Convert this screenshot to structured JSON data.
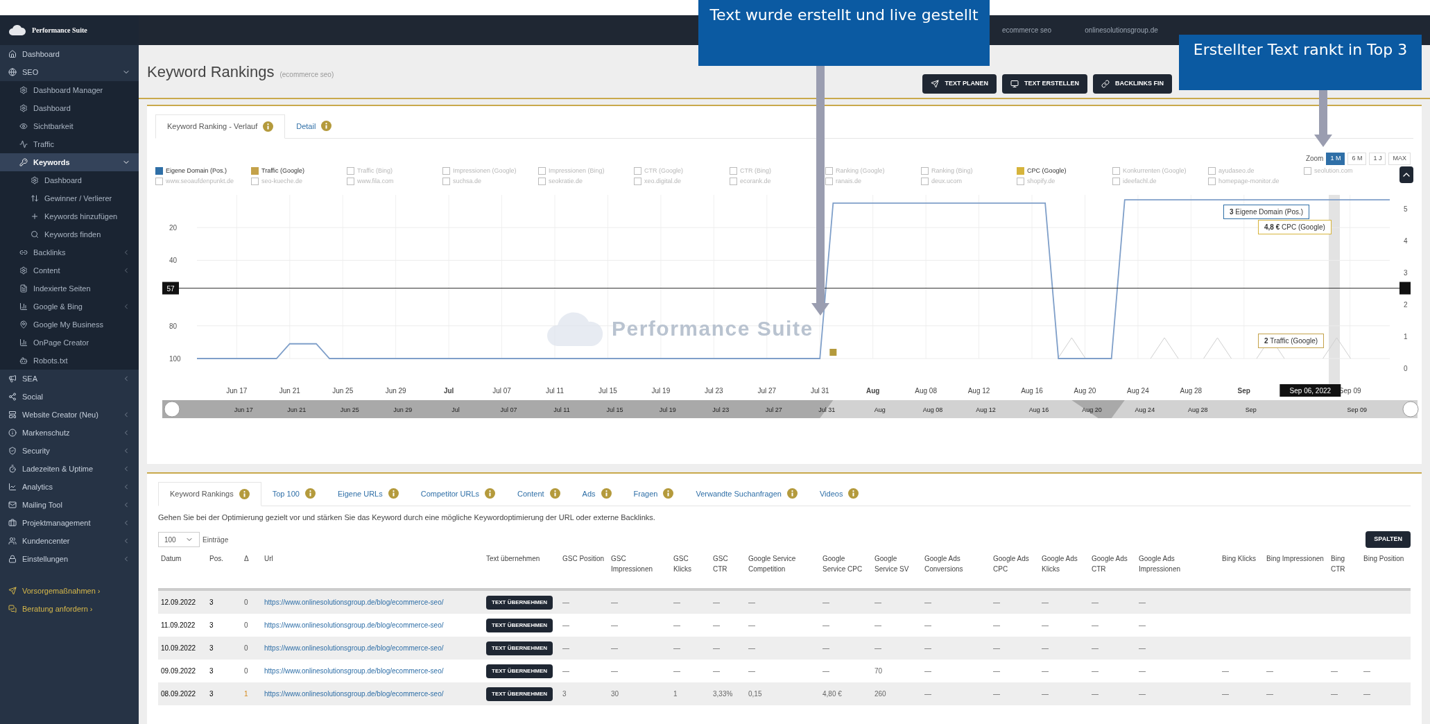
{
  "annotations": [
    {
      "text": "Text wurde erstellt und live gestellt"
    },
    {
      "text": "Erstellter Text rankt in Top 3"
    }
  ],
  "sidebar": {
    "logo": "Performance Suite",
    "items": [
      {
        "label": "Dashboard"
      },
      {
        "label": "SEO",
        "expanded": true,
        "children": [
          {
            "label": "Dashboard Manager"
          },
          {
            "label": "Dashboard"
          },
          {
            "label": "Sichtbarkeit"
          },
          {
            "label": "Traffic"
          },
          {
            "label": "Keywords",
            "selected": true,
            "expanded": true,
            "children": [
              {
                "label": "Dashboard"
              },
              {
                "label": "Gewinner / Verlierer"
              },
              {
                "label": "Keywords hinzufügen"
              },
              {
                "label": "Keywords finden"
              }
            ]
          },
          {
            "label": "Backlinks",
            "expanded": false
          },
          {
            "label": "Content",
            "expanded": false
          },
          {
            "label": "Indexierte Seiten"
          },
          {
            "label": "Google & Bing",
            "expanded": false
          },
          {
            "label": "Google My Business"
          },
          {
            "label": "OnPage Creator"
          },
          {
            "label": "Robots.txt"
          }
        ]
      },
      {
        "label": "SEA",
        "expanded": false
      },
      {
        "label": "Social"
      },
      {
        "label": "Website Creator (Neu)",
        "expanded": false
      },
      {
        "label": "Markenschutz",
        "expanded": false
      },
      {
        "label": "Security",
        "expanded": false
      },
      {
        "label": "Ladezeiten & Uptime",
        "expanded": false
      },
      {
        "label": "Analytics",
        "expanded": false
      },
      {
        "label": "Mailing Tool",
        "expanded": false
      },
      {
        "label": "Projektmanagement",
        "expanded": false
      },
      {
        "label": "Kundencenter",
        "expanded": false
      },
      {
        "label": "Einstellungen",
        "expanded": false
      }
    ],
    "extras": [
      {
        "label": "Vorsorgemaßnahmen ›"
      },
      {
        "label": "Beratung anfordern ›"
      }
    ]
  },
  "topbar": {
    "project": "ecommerce seo",
    "account": "onlinesolutionsgroup.de"
  },
  "header": {
    "title": "Keyword Rankings",
    "subtitle": "(ecommerce seo)",
    "buttons": [
      "TEXT PLANEN",
      "TEXT ERSTELLEN",
      "BACKLINKS FIN"
    ]
  },
  "chart_panel": {
    "tabs": [
      {
        "label": "Keyword Ranking - Verlauf",
        "selected": true
      },
      {
        "label": "Detail",
        "selected": false
      }
    ],
    "zoom_label": "Zoom",
    "ranges": [
      {
        "label": "1 M",
        "selected": true
      },
      {
        "label": "6 M",
        "selected": false
      },
      {
        "label": "1 J",
        "selected": false
      },
      {
        "label": "MAX",
        "selected": false
      }
    ],
    "legend_rows": [
      [
        {
          "label": "Eigene Domain (Pos.)",
          "checked": true,
          "color": "#2f6fa7"
        },
        {
          "label": "Traffic (Google)",
          "checked": true,
          "color": "#c4a24a"
        },
        {
          "label": "Traffic (Bing)",
          "checked": false
        },
        {
          "label": "Impressionen (Google)",
          "checked": false
        },
        {
          "label": "Impressionen (Bing)",
          "checked": false
        },
        {
          "label": "CTR (Google)",
          "checked": false
        },
        {
          "label": "CTR (Bing)",
          "checked": false
        },
        {
          "label": "Ranking (Google)",
          "checked": false
        },
        {
          "label": "Ranking (Bing)",
          "checked": false
        },
        {
          "label": "CPC (Google)",
          "checked": true,
          "color": "#d6b43c"
        },
        {
          "label": "Konkurrenten (Google)",
          "checked": false
        },
        {
          "label": "ayudaseo.de",
          "checked": false
        },
        {
          "label": "seolution.com",
          "checked": false
        }
      ],
      [
        {
          "label": "www.seoaufdenpunkt.de",
          "checked": false
        },
        {
          "label": "seo-kueche.de",
          "checked": false
        },
        {
          "label": "www.fila.com",
          "checked": false
        },
        {
          "label": "suchsa.de",
          "checked": false
        },
        {
          "label": "seokratie.de",
          "checked": false
        },
        {
          "label": "xeo.digital.de",
          "checked": false
        },
        {
          "label": "ecorank.de",
          "checked": false
        },
        {
          "label": "ranais.de",
          "checked": false
        },
        {
          "label": "deux.ucom",
          "checked": false
        },
        {
          "label": "shopify.de",
          "checked": false
        },
        {
          "label": "ideefachl.de",
          "checked": false
        },
        {
          "label": "homepage-monitor.de",
          "checked": false
        }
      ]
    ],
    "watermark": "Performance Suite",
    "chart_data": {
      "type": "line",
      "categories": [
        null,
        null,
        null,
        "Jun 17",
        null,
        null,
        null,
        "Jun 21",
        null,
        null,
        null,
        "Jun 25",
        null,
        null,
        null,
        "Jun 29",
        null,
        null,
        null,
        "Jul",
        null,
        null,
        null,
        "Jul 07",
        null,
        null,
        null,
        "Jul 11",
        null,
        null,
        null,
        "Jul 15",
        null,
        null,
        null,
        "Jul 19",
        null,
        null,
        null,
        "Jul 23",
        null,
        null,
        null,
        "Jul 27",
        null,
        null,
        null,
        "Jul 31",
        null,
        null,
        null,
        "Aug",
        null,
        null,
        null,
        "Aug 08",
        null,
        null,
        null,
        "Aug 12",
        null,
        null,
        null,
        "Aug 16",
        null,
        null,
        null,
        "Aug 20",
        null,
        null,
        null,
        "Aug 24",
        null,
        null,
        null,
        "Aug 28",
        null,
        null,
        null,
        "Sep",
        null,
        null,
        null,
        null,
        null,
        null,
        null,
        "Sep 09",
        null,
        null,
        null
      ],
      "series": [
        {
          "name": "Eigene Domain (Pos.)",
          "color": "#7f9fc9",
          "values": [
            100,
            100,
            100,
            100,
            100,
            100,
            100,
            91,
            91,
            91,
            100,
            100,
            100,
            100,
            100,
            100,
            100,
            100,
            100,
            100,
            100,
            100,
            100,
            100,
            100,
            100,
            100,
            100,
            100,
            100,
            100,
            100,
            100,
            100,
            100,
            100,
            100,
            100,
            100,
            100,
            100,
            100,
            100,
            100,
            100,
            100,
            100,
            100,
            5,
            5,
            5,
            5,
            5,
            5,
            5,
            5,
            5,
            5,
            5,
            5,
            5,
            5,
            5,
            5,
            5,
            100,
            100,
            100,
            100,
            100,
            3,
            3,
            3,
            3,
            3,
            3,
            3,
            3,
            3,
            3,
            3,
            3,
            3,
            3,
            3,
            3,
            3,
            3,
            3,
            3,
            3
          ]
        }
      ],
      "ylim": [
        100,
        0
      ],
      "grid": true,
      "ref_lines": [
        {
          "axis": "y",
          "value": 57
        }
      ],
      "yticks": [
        20,
        40,
        80,
        100
      ]
    },
    "right_axis": [
      "5",
      "4",
      "3",
      "2",
      "1",
      "0"
    ],
    "crosshair": {
      "value": "57",
      "date": "Sep 06, 2022"
    },
    "tooltips": [
      {
        "kind": "series",
        "value": "3"
      },
      {
        "kind": "other",
        "value": "4,8 €",
        "label": "CPC (Google)"
      },
      {
        "kind": "other",
        "value": "2",
        "label": "Traffic (Google)"
      }
    ],
    "navigator_labels": [
      "Jun 17",
      "Jun 21",
      "Jun 25",
      "Jun 29",
      "Jul",
      "Jul 07",
      "Jul 11",
      "Jul 15",
      "Jul 19",
      "Jul 23",
      "Jul 27",
      "Jul 31",
      "Aug",
      "Aug 08",
      "Aug 12",
      "Aug 16",
      "Aug 20",
      "Aug 24",
      "Aug 28",
      "Sep",
      "Sep 09"
    ]
  },
  "table_panel": {
    "tabs": [
      {
        "label": "Keyword Rankings",
        "selected": true
      },
      {
        "label": "Top 100",
        "selected": false
      },
      {
        "label": "Eigene URLs",
        "selected": false
      },
      {
        "label": "Competitor URLs",
        "selected": false
      },
      {
        "label": "Content",
        "selected": false
      },
      {
        "label": "Ads",
        "selected": false
      },
      {
        "label": "Fragen",
        "selected": false
      },
      {
        "label": "Verwandte Suchanfragen",
        "selected": false
      },
      {
        "label": "Videos",
        "selected": false
      }
    ],
    "description": "Gehen Sie bei der Optimierung gezielt vor und stärken Sie das Keyword durch eine mögliche Keywordoptimierung der URL oder externe Backlinks.",
    "page_size": "100",
    "page_size_label": "Einträge",
    "columns_button": "SPALTEN",
    "columns": [
      "Datum",
      "Pos.",
      "Δ",
      "Url",
      "Text übernehmen",
      "GSC Position",
      "GSC Impressionen",
      "GSC Klicks",
      "GSC CTR",
      "Google Service Competition",
      "Google Service CPC",
      "Google Service SV",
      "Google Ads Conversions",
      "Google Ads CPC",
      "Google Ads Klicks",
      "Google Ads CTR",
      "Google Ads Impressionen",
      "Bing Klicks",
      "Bing Impressionen",
      "Bing CTR",
      "Bing Position"
    ],
    "rows": [
      {
        "changed": false,
        "cells": [
          "12.09.2022",
          "3",
          "0",
          "https://www.onlinesolutionsgroup.de/blog/ecommerce-seo/",
          "TEXT ÜBERNEHMEN",
          "—",
          "—",
          "—",
          "—",
          "—",
          "—",
          "—",
          "—",
          "—",
          "—",
          "—",
          "—",
          null,
          null,
          null,
          null
        ]
      },
      {
        "changed": false,
        "cells": [
          "11.09.2022",
          "3",
          "0",
          "https://www.onlinesolutionsgroup.de/blog/ecommerce-seo/",
          "TEXT ÜBERNEHMEN",
          "—",
          "—",
          "—",
          "—",
          "—",
          "—",
          "—",
          "—",
          "—",
          "—",
          "—",
          "—",
          null,
          null,
          null,
          null
        ]
      },
      {
        "changed": false,
        "cells": [
          "10.09.2022",
          "3",
          "0",
          "https://www.onlinesolutionsgroup.de/blog/ecommerce-seo/",
          "TEXT ÜBERNEHMEN",
          "—",
          "—",
          "—",
          "—",
          "—",
          "—",
          "—",
          "—",
          "—",
          "—",
          "—",
          "—",
          null,
          null,
          null,
          null
        ]
      },
      {
        "changed": false,
        "cells": [
          "09.09.2022",
          "3",
          "0",
          "https://www.onlinesolutionsgroup.de/blog/ecommerce-seo/",
          "TEXT ÜBERNEHMEN",
          "—",
          "—",
          "—",
          "—",
          "—",
          "—",
          "70",
          "—",
          "—",
          "—",
          "—",
          "—",
          "—",
          "—",
          "—",
          "—"
        ]
      },
      {
        "changed": true,
        "cells": [
          "08.09.2022",
          "3",
          "1",
          "https://www.onlinesolutionsgroup.de/blog/ecommerce-seo/",
          "TEXT ÜBERNEHMEN",
          "3",
          "30",
          "1",
          "3,33%",
          "0,15",
          "4,80 €",
          "260",
          "—",
          "—",
          "—",
          "—",
          "—",
          "—",
          "—",
          "—",
          "—"
        ]
      }
    ]
  }
}
